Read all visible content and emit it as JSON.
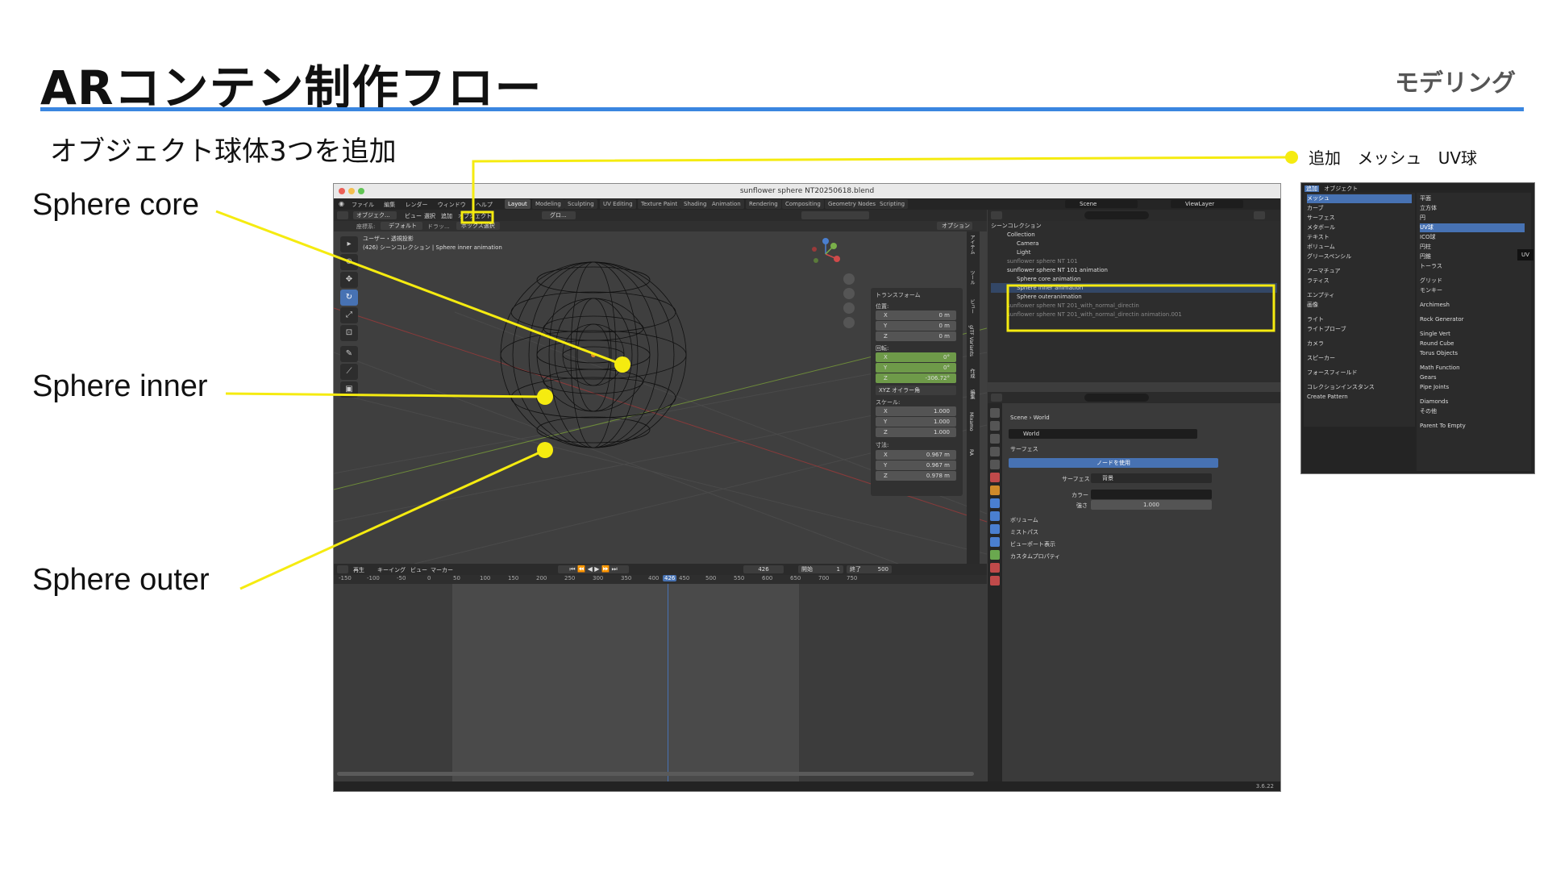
{
  "slide": {
    "title": "ARコンテン制作フロー",
    "section": "モデリング",
    "subtitle": "オブジェクト球体3つを追加",
    "menu_path": "追加 メッシュ UV球",
    "callouts": [
      "Sphere core",
      "Sphere inner",
      "Sphere outer"
    ],
    "accent_color": "#3a86e0",
    "callout_color": "#f5eb10"
  },
  "blender": {
    "window_title": "sunflower sphere NT20250618.blend",
    "menus": [
      "ファイル",
      "編集",
      "レンダー",
      "ウィンドウ",
      "ヘルプ"
    ],
    "workspaces": [
      "Layout",
      "Modeling",
      "Sculpting",
      "UV Editing",
      "Texture Paint",
      "Shading",
      "Animation",
      "Rendering",
      "Compositing",
      "Geometry Nodes",
      "Scripting"
    ],
    "scene_name": "Scene",
    "view_layer": "ViewLayer",
    "viewport": {
      "header_items": [
        "オブジェク...",
        "ビュー",
        "選択",
        "追加",
        "オブジェクト"
      ],
      "pivot": "グロ...",
      "transform_label": "座標系:",
      "transform_value": "デフォルト",
      "drag_label": "ドラッ...",
      "select_mode": "ボックス選択",
      "options": "オプション",
      "view_info": "ユーザー・透視投影",
      "object_info": "(426) シーンコレクション | Sphere inner animation"
    },
    "n_panel": {
      "header": "トランスフォーム",
      "location_label": "位置:",
      "location": [
        {
          "axis": "X",
          "value": "0 m"
        },
        {
          "axis": "Y",
          "value": "0 m"
        },
        {
          "axis": "Z",
          "value": "0 m"
        }
      ],
      "rotation_label": "回転:",
      "rotation": [
        {
          "axis": "X",
          "value": "0°"
        },
        {
          "axis": "Y",
          "value": "0°"
        },
        {
          "axis": "Z",
          "value": "-306.72°"
        }
      ],
      "rotation_mode": "XYZ オイラー角",
      "scale_label": "スケール:",
      "scale": [
        {
          "axis": "X",
          "value": "1.000"
        },
        {
          "axis": "Y",
          "value": "1.000"
        },
        {
          "axis": "Z",
          "value": "1.000"
        }
      ],
      "dimensions_label": "寸法:",
      "dimensions": [
        {
          "axis": "X",
          "value": "0.967 m"
        },
        {
          "axis": "Y",
          "value": "0.967 m"
        },
        {
          "axis": "Z",
          "value": "0.978 m"
        }
      ]
    },
    "side_tabs": [
      "アイテム",
      "ツール",
      "ビュー",
      "gITF Variants",
      "作成",
      "編集",
      "Mixamo",
      "RA"
    ],
    "timeline": {
      "header_items": [
        "再生",
        "キーイング",
        "ビュー",
        "マーカー"
      ],
      "current_frame": "426",
      "start_label": "開始",
      "start": "1",
      "end_label": "終了",
      "end": "500",
      "ruler": [
        "-150",
        "-100",
        "-50",
        "0",
        "50",
        "100",
        "150",
        "200",
        "250",
        "300",
        "350",
        "400",
        "426",
        "450",
        "500",
        "550",
        "600",
        "650",
        "700",
        "750"
      ]
    },
    "outliner": {
      "title": "シーンコレクション",
      "rows": [
        {
          "label": "Collection",
          "indent": 1
        },
        {
          "label": "Camera",
          "indent": 2
        },
        {
          "label": "Light",
          "indent": 2
        },
        {
          "label": "sunflower sphere NT 101",
          "indent": 1
        },
        {
          "label": "sunflower sphere NT 101 animation",
          "indent": 1
        },
        {
          "label": "Sphere core animation",
          "indent": 2
        },
        {
          "label": "Sphere inner animation",
          "indent": 2
        },
        {
          "label": "Sphere outeranimation",
          "indent": 2
        },
        {
          "label": "sunflower sphere NT 201_with_normal_directin",
          "indent": 1
        },
        {
          "label": "sunflower sphere NT 201_with_normal_directin animation.001",
          "indent": 1
        }
      ]
    },
    "properties": {
      "breadcrumb_scene": "Scene",
      "breadcrumb_world": "World",
      "world_name": "World",
      "surface_panel": "サーフェス",
      "use_nodes": "ノードを使用",
      "surface_label": "サーフェス",
      "surface_value": "背景",
      "color_label": "カラー",
      "strength_label": "強さ",
      "strength_value": "1.000",
      "collapsed_panels": [
        "ボリューム",
        "ミストパス",
        "ビューポート表示",
        "カスタムプロパティ"
      ]
    },
    "version": "3.6.22"
  },
  "add_menu": {
    "tabs": [
      "追加",
      "オブジェクト"
    ],
    "categories": [
      "メッシュ",
      "カーブ",
      "サーフェス",
      "メタボール",
      "テキスト",
      "ボリューム",
      "グリースペンシル",
      "アーマチュア",
      "ラティス",
      "エンプティ",
      "画像",
      "ライト",
      "ライトプローブ",
      "カメラ",
      "スピーカー",
      "フォースフィールド",
      "コレクションインスタンス",
      "Create Pattern"
    ],
    "mesh_items": [
      "平面",
      "立方体",
      "円",
      "UV球",
      "ICO球",
      "円柱",
      "円錐",
      "トーラス",
      "グリッド",
      "モンキー",
      "Archimesh",
      "Rock Generator",
      "Single Vert",
      "Round Cube",
      "Torus Objects",
      "Math Function",
      "Gears",
      "Pipe Joints",
      "Diamonds",
      "その他",
      "Parent To Empty"
    ],
    "tooltip": "UV"
  }
}
